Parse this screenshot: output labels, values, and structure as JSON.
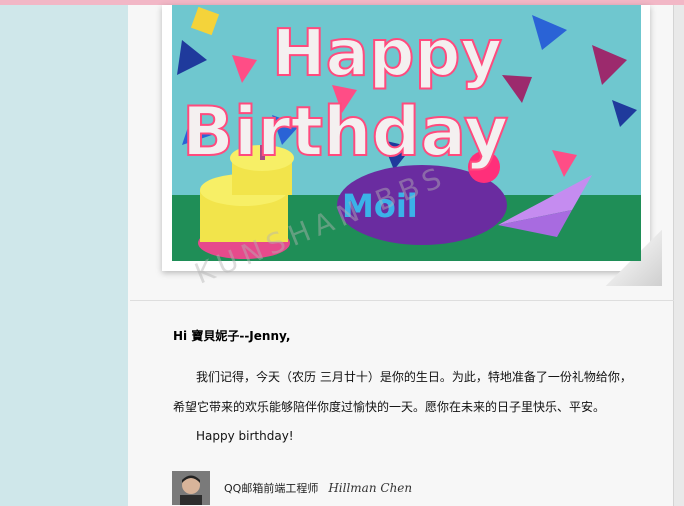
{
  "photo": {
    "headline_line1": "Happy",
    "headline_line2": "Birthday",
    "brand": "Moil"
  },
  "watermark": "KUNSHAN BBS",
  "letter": {
    "greeting": "Hi 寶貝妮子--Jenny,",
    "paragraph1": "我们记得，今天（农历 三月廿十）是你的生日。为此，特地准备了一份礼物给你，希望它带来的欢乐能够陪伴你度过愉快的一天。愿你在未来的日子里快乐、平安。",
    "paragraph2": "Happy birthday!"
  },
  "signature": {
    "title": "QQ邮箱前端工程师",
    "name": "Hillman Chen"
  },
  "colors": {
    "page_bg": "#cfe7ea",
    "top_strip": "#f2b7c6",
    "paper": "#f7f7f7"
  }
}
